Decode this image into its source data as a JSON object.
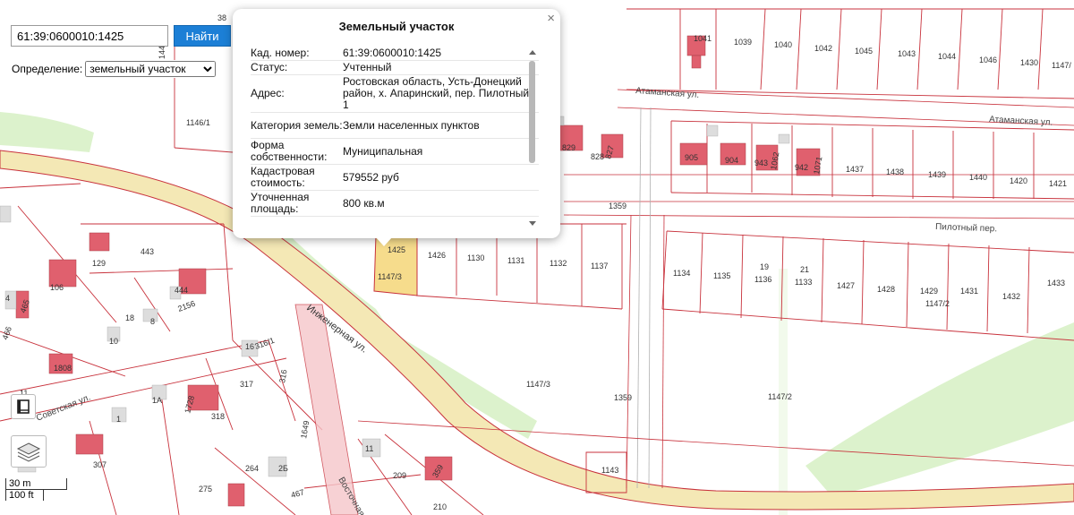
{
  "search": {
    "value": "61:39:0600010:1425",
    "button_label": "Найти"
  },
  "definition": {
    "label": "Определение:",
    "selected": "земельный участок"
  },
  "popup": {
    "title": "Земельный участок",
    "close": "×",
    "rows": [
      {
        "key": "Кад. номер:",
        "value": "61:39:0600010:1425"
      },
      {
        "key": "Статус:",
        "value": "Учтенный"
      },
      {
        "key": "Адрес:",
        "value": "Ростовская область, Усть-Донецкий район, х. Апаринский, пер. Пилотный, 1"
      },
      {
        "key": "Категория земель:",
        "value": "Земли населенных пунктов"
      },
      {
        "key": "Форма собственности:",
        "value": "Муниципальная"
      },
      {
        "key": "Кадастровая стоимость:",
        "value": "579552 руб"
      },
      {
        "key": "Уточненная площадь:",
        "value": "800 кв.м"
      }
    ]
  },
  "streets": {
    "atamanskaya_1": "Атаманская ул.",
    "atamanskaya_2": "Атаманская ул.",
    "pilotny": "Пилотный пер.",
    "inzhenernaya": "Инженерная ул.",
    "sovetskaya": "Советская ул.",
    "vostochnaya": "Восточная"
  },
  "labels": {
    "l1041": "1041",
    "l1039": "1039",
    "l1040": "1040",
    "l1042": "1042",
    "l1045": "1045",
    "l1043": "1043",
    "l1044": "1044",
    "l1046": "1046",
    "l1430": "1430",
    "l11471r": "1147/",
    "l1437": "1437",
    "l1438": "1438",
    "l1439": "1439",
    "l1440": "1440",
    "l1420": "1420",
    "l1421": "1421",
    "l905": "905",
    "l904": "904",
    "l943": "943",
    "l1062": "1062",
    "l942": "942",
    "l1071": "1071",
    "l829": "829",
    "l828": "828",
    "l827": "827",
    "l1359a": "1359",
    "l1359b": "1359",
    "l1425": "1425",
    "l11473a": "1147/3",
    "l1426": "1426",
    "l1130": "1130",
    "l1131": "1131",
    "l1132": "1132",
    "l1137": "1137",
    "l1134": "1134",
    "l1135": "1135",
    "l19": "19",
    "l1136": "1136",
    "l21": "21",
    "l1133": "1133",
    "l1427": "1427",
    "l1428": "1428",
    "l1429": "1429",
    "l11472a": "1147/2",
    "l1431": "1431",
    "l1432": "1432",
    "l1433": "1433",
    "l11473b": "1147/3",
    "l11472b": "1147/2",
    "l1143": "1143",
    "l11461": "1146/1",
    "l144": "144",
    "l38": "38",
    "l129": "129",
    "l443": "443",
    "l106": "106",
    "l465": "465",
    "l444": "444",
    "l2156": "2156",
    "l18": "18",
    "l10": "10",
    "l466": "466",
    "l1808": "1808",
    "l16": "16",
    "l3161": "316/1",
    "l316": "316",
    "l317": "317",
    "l11": "11",
    "l1a": "1А",
    "l1728": "1728",
    "l318": "318",
    "l1": "1",
    "l307": "307",
    "l264": "264",
    "l2b": "2Б",
    "l275": "275",
    "l467": "467",
    "l209": "209",
    "l359": "359",
    "l210": "210",
    "l11b": "11",
    "l8": "8",
    "l4": "4",
    "l1649": "1649"
  },
  "scale": {
    "metric": "30 m",
    "imperial": "100 ft"
  },
  "icons": {
    "legend": "legend-book-icon",
    "layers": "layers-icon"
  },
  "colors": {
    "boundary": "#c8323c",
    "selected_parcel": "#f6dc8c",
    "building": "#e0606e",
    "road": "#f3e7b4",
    "green": "#d9f0c8",
    "accent": "#1c7fd6"
  }
}
